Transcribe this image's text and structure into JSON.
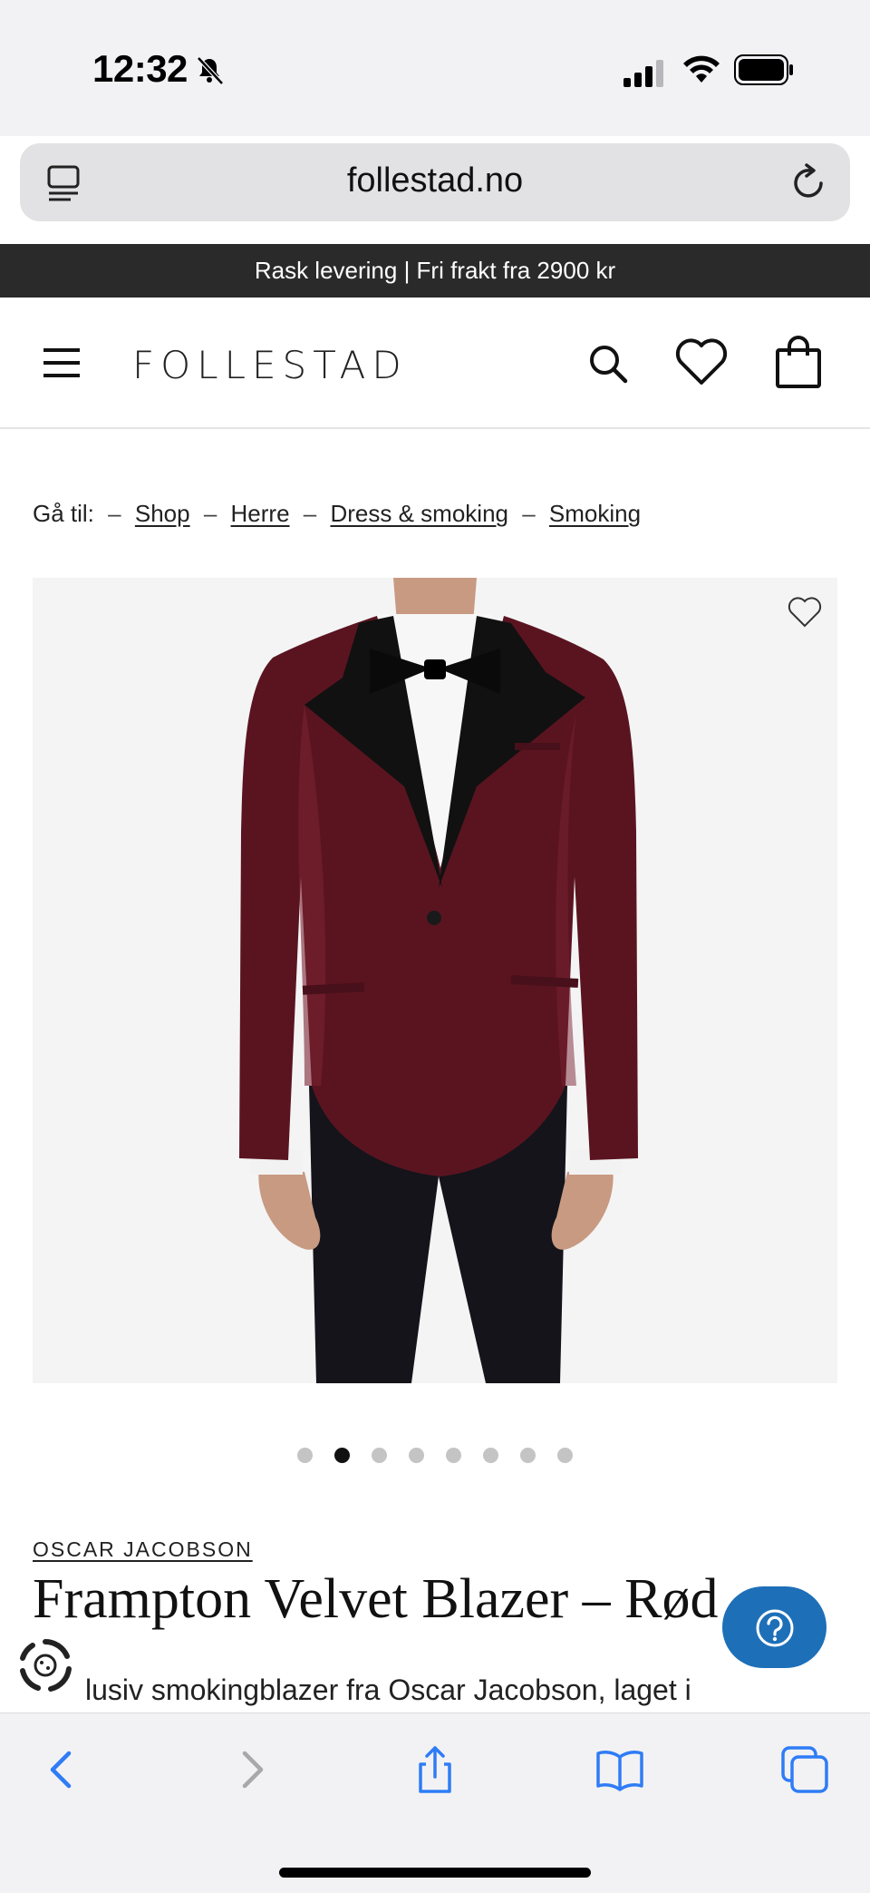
{
  "status_bar": {
    "time": "12:32"
  },
  "browser": {
    "url": "follestad.no"
  },
  "promo": {
    "text": "Rask levering | Fri frakt fra 2900 kr"
  },
  "header": {
    "logo": "FOLLESTAD"
  },
  "breadcrumb": {
    "prefix": "Gå til:",
    "separator": "–",
    "items": [
      "Shop",
      "Herre",
      "Dress & smoking",
      "Smoking"
    ]
  },
  "carousel": {
    "total": 8,
    "active_index": 1
  },
  "product": {
    "brand": "OSCAR JACOBSON",
    "title": "Frampton Velvet Blazer – Rød",
    "description_visible": "lusiv smokingblazer fra Oscar Jacobson, laget i"
  },
  "colors": {
    "promo_bg": "#2a2a2a",
    "accent_blue": "#1d6fb8",
    "ios_blue": "#2f7cf6",
    "velvet": "#5a1420"
  },
  "icons": {
    "status": [
      "bell-slash-icon",
      "signal-icon",
      "wifi-icon",
      "battery-icon"
    ],
    "header": [
      "menu-icon",
      "search-icon",
      "heart-icon",
      "shopping-bag-icon"
    ],
    "toolbar": [
      "back-icon",
      "forward-icon",
      "share-icon",
      "bookmarks-icon",
      "tabs-icon"
    ]
  }
}
